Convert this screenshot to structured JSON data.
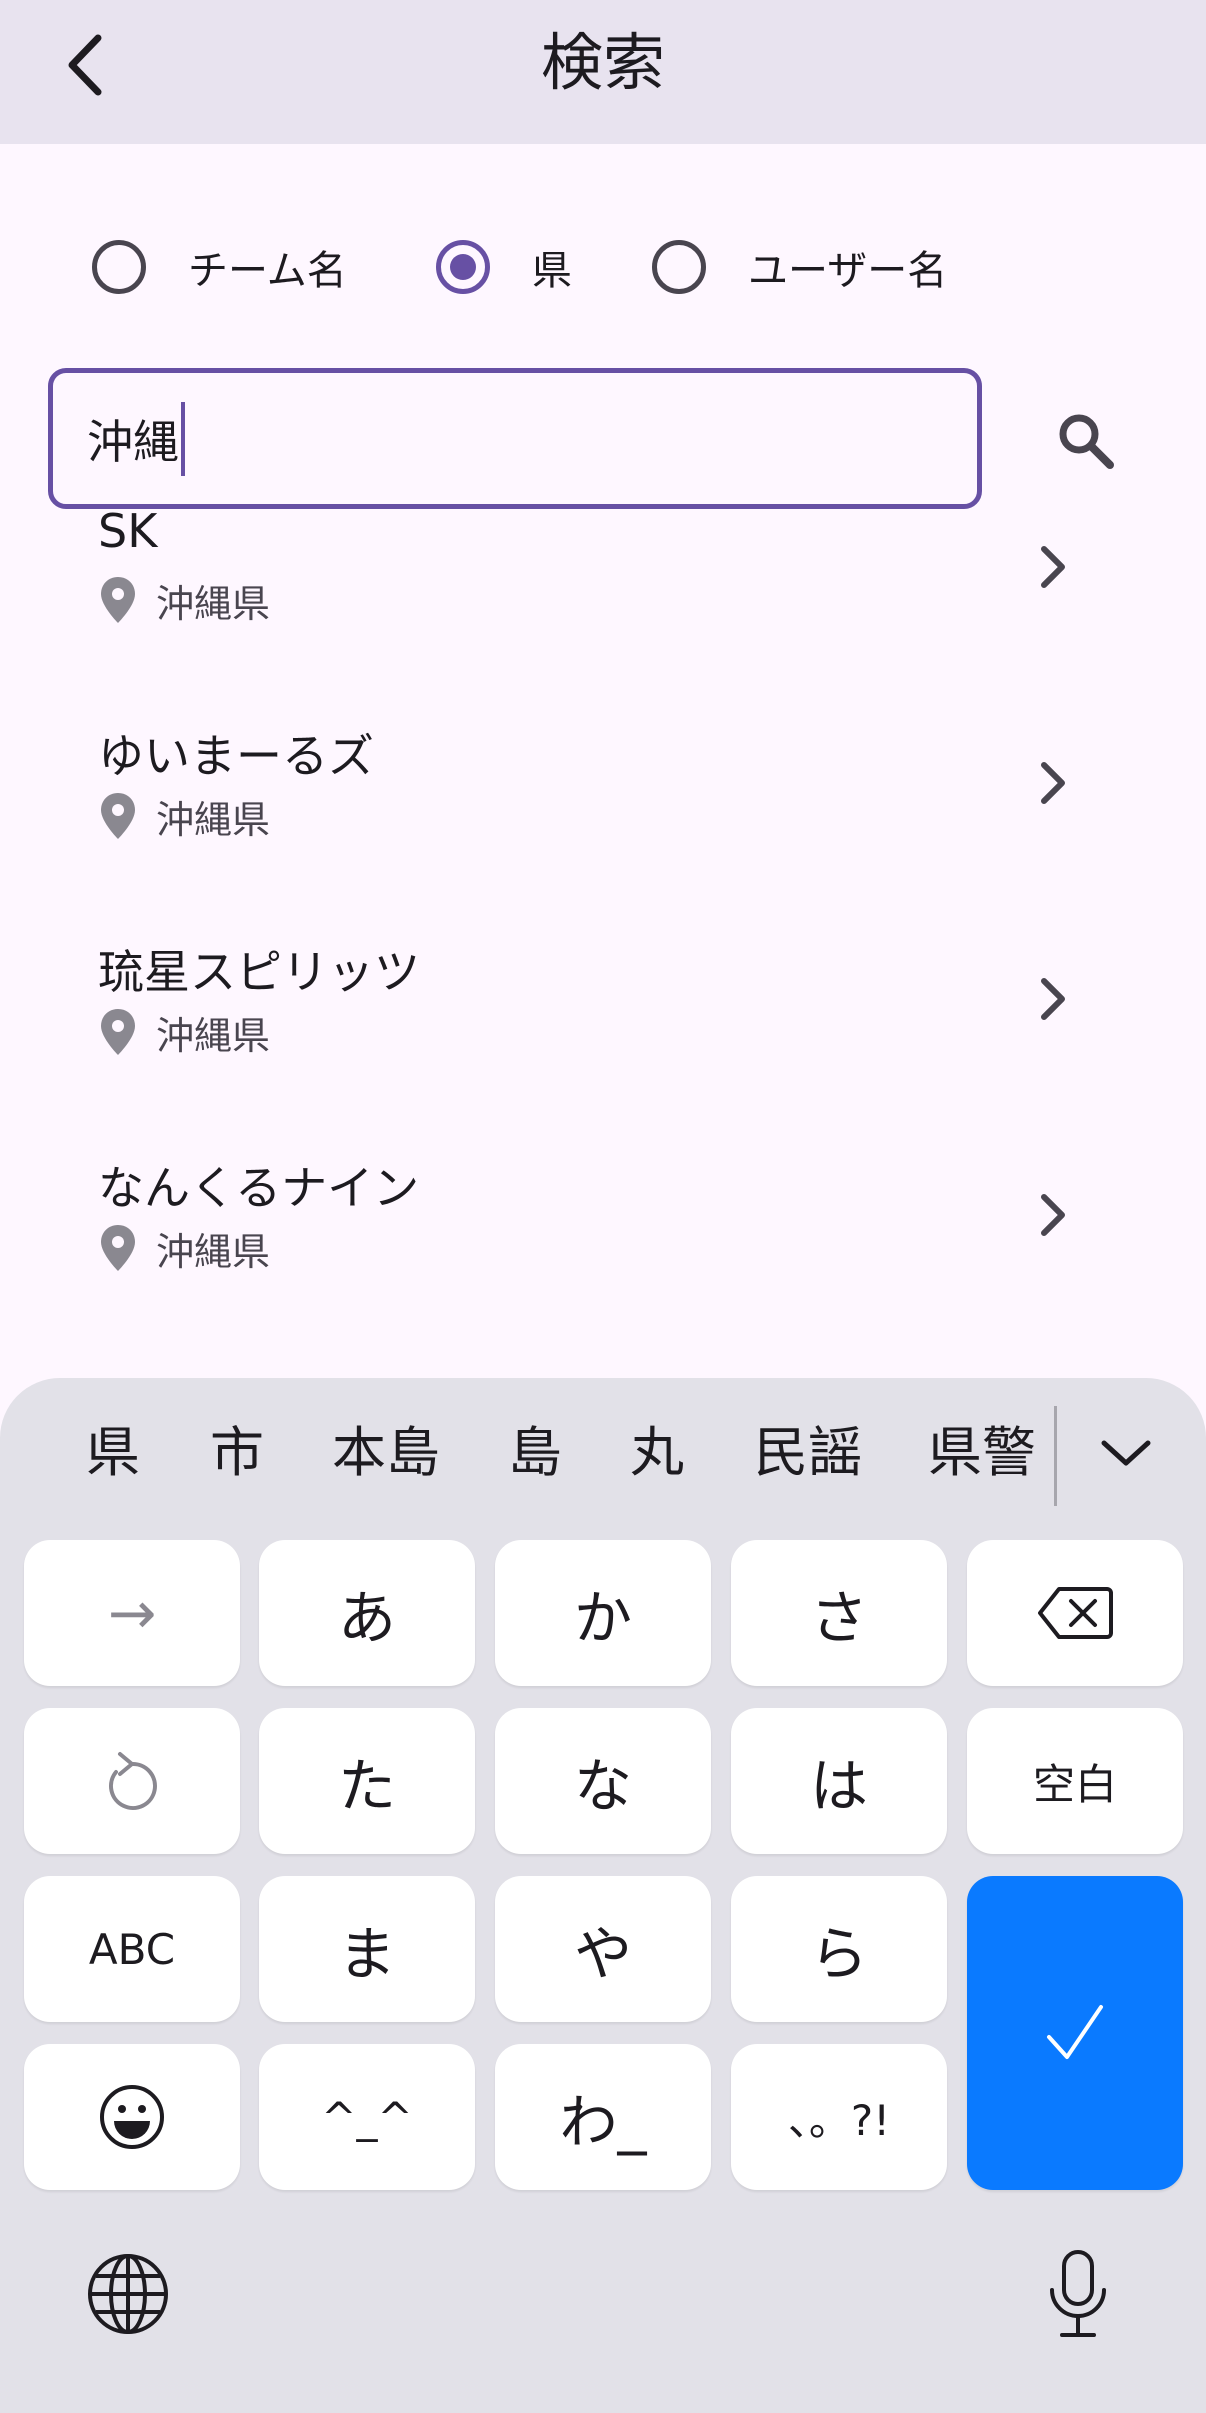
{
  "header": {
    "title": "検索"
  },
  "search_type": {
    "options": [
      {
        "label": "チーム名",
        "selected": false
      },
      {
        "label": "県",
        "selected": true
      },
      {
        "label": "ユーザー名",
        "selected": false
      }
    ]
  },
  "search": {
    "value": "沖縄"
  },
  "results": [
    {
      "name": "SK",
      "location": "沖縄県"
    },
    {
      "name": "ゆいまーるズ",
      "location": "沖縄県"
    },
    {
      "name": "琉星スピリッツ",
      "location": "沖縄県"
    },
    {
      "name": "なんくるナイン",
      "location": "沖縄県"
    }
  ],
  "keyboard": {
    "candidates": [
      "県",
      "市",
      "本島",
      "島",
      "丸",
      "民謡",
      "県警"
    ],
    "keys": {
      "next": "→",
      "a": "あ",
      "ka": "か",
      "sa": "さ",
      "ta": "た",
      "na": "な",
      "ha": "は",
      "space": "空白",
      "abc": "ABC",
      "ma": "ま",
      "ya": "や",
      "ra": "ら",
      "kaomoji": "^_^",
      "wa": "わ_",
      "punct": "、。?!"
    },
    "colors": {
      "enter": "#0a7aff",
      "accent": "#6750a4"
    }
  }
}
